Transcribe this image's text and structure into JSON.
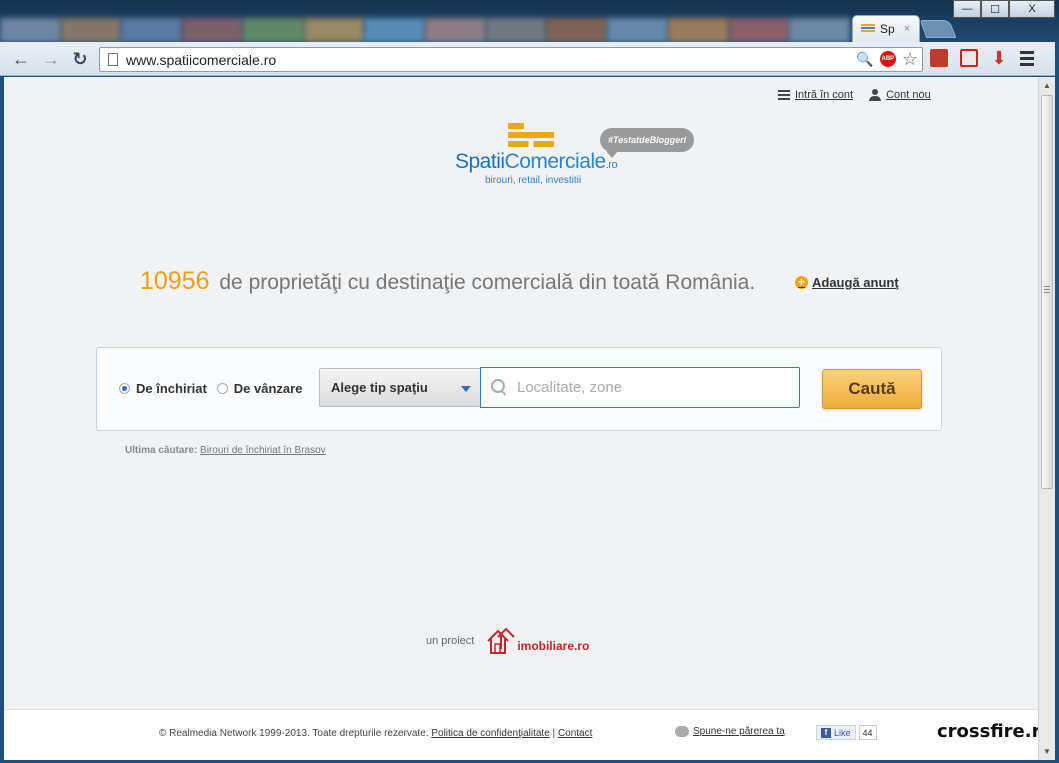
{
  "browser": {
    "tab_title": "Sp",
    "tab_close": "×",
    "url": "www.spatiicomerciale.ro",
    "abp_label": "ABP",
    "window_min": "—",
    "window_max": "☐",
    "window_close": "X",
    "back_glyph": "←",
    "forward_glyph": "→",
    "reload_glyph": "↻"
  },
  "header": {
    "login_label": "Intră în cont",
    "account_label": "Cont nou"
  },
  "logo": {
    "name_part1": "Spatii",
    "name_part2": "Comerciale",
    "name_suffix": ".ro",
    "tagline": "birouri, retail, investitii",
    "badge": "#TestatdeBloggeri"
  },
  "hero": {
    "count": "10956",
    "headline": "de proprietăţi cu destinaţie comercială din toată România.",
    "add_listing": "Adaugă anunţ"
  },
  "search": {
    "option_rent": "De închiriat",
    "option_sale": "De vânzare",
    "type_select": "Alege tip spaţiu",
    "location_placeholder": "Localitate, zone",
    "submit_label": "Caută",
    "selected_option": "De închiriat"
  },
  "last_search": {
    "label": "Ultima căutare:",
    "link": "Birouri de închiriat în Brasov"
  },
  "project": {
    "label": "un proiect",
    "brand": "imobiliare.ro"
  },
  "footer": {
    "copyright": "© Realmedia Network 1999-2013. Toate drepturile rezervate.",
    "privacy_link": "Politica de confidenţialitate",
    "separator": "|",
    "contact_link": "Contact",
    "feedback_link": "Spune-ne părerea ta",
    "fb_like": "Like",
    "fb_count": "44"
  },
  "watermark": "crossfire.ro",
  "colors": {
    "accent_orange": "#f39c1a",
    "brand_blue": "#2b83c8",
    "imobiliare_red": "#c0272d"
  }
}
